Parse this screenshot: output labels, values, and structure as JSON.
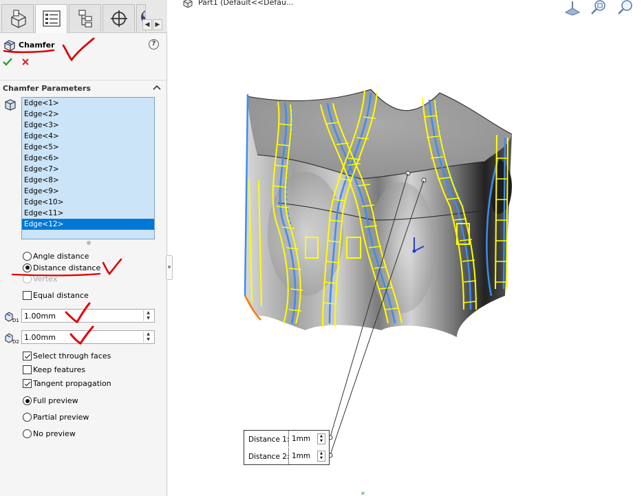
{
  "tree": {
    "part_label": "Part1  (Default<<Defau..."
  },
  "feature": {
    "title": "Chamfer",
    "help": "?"
  },
  "group": {
    "title": "Chamfer Parameters"
  },
  "edges": [
    "Edge<1>",
    "Edge<2>",
    "Edge<3>",
    "Edge<4>",
    "Edge<5>",
    "Edge<6>",
    "Edge<7>",
    "Edge<8>",
    "Edge<9>",
    "Edge<10>",
    "Edge<11>",
    "Edge<12>"
  ],
  "selected_edge_index": 11,
  "chamfer_type": {
    "options": [
      {
        "label": "Angle distance",
        "checked": false,
        "disabled": false
      },
      {
        "label": "Distance distance",
        "checked": true,
        "disabled": false
      },
      {
        "label": "Vertex",
        "checked": false,
        "disabled": true
      }
    ]
  },
  "equal_distance": {
    "label": "Equal distance",
    "checked": false
  },
  "distance1": {
    "value": "1.00mm",
    "icon_label": "D1"
  },
  "distance2": {
    "value": "1.00mm",
    "icon_label": "D2"
  },
  "options": [
    {
      "label": "Select through faces",
      "checked": true
    },
    {
      "label": "Keep features",
      "checked": false
    },
    {
      "label": "Tangent propagation",
      "checked": true
    }
  ],
  "preview": {
    "options": [
      {
        "label": "Full preview",
        "checked": true
      },
      {
        "label": "Partial preview",
        "checked": false
      },
      {
        "label": "No preview",
        "checked": false
      }
    ]
  },
  "callout": {
    "rows": [
      {
        "label": "Distance 1:",
        "value": "1mm"
      },
      {
        "label": "Distance 2:",
        "value": "1mm"
      }
    ]
  },
  "colors": {
    "selection_blue": "#0078d7",
    "list_bg": "#cce4f7",
    "highlight_yellow": "#ffff00",
    "edge_blue": "#3a8df0",
    "annotation_red": "#e00000",
    "ok_green": "#2e9e2e",
    "cancel_red": "#d02020"
  }
}
